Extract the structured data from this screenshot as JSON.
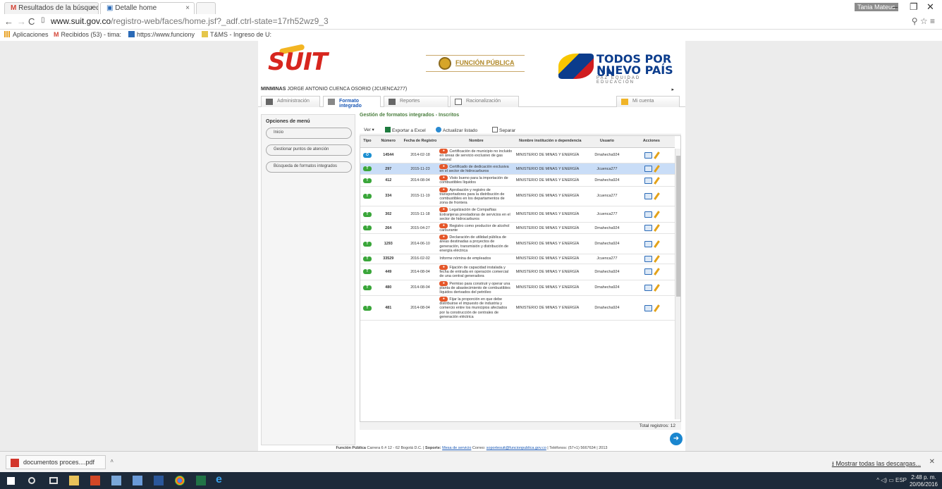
{
  "browser": {
    "tabs": [
      {
        "label": "Resultados de la búsqued",
        "active": false
      },
      {
        "label": "Detalle home",
        "active": true
      }
    ],
    "user_name": "Tania Mateus",
    "url_host": "www.suit.gov.co",
    "url_path": "/registro-web/faces/home.jsf?_adf.ctrl-state=17rh52wz9_3",
    "bookmarks": [
      {
        "label": "Aplicaciones",
        "icon": "apps-icon"
      },
      {
        "label": "Recibidos (53) - tima:",
        "icon": "gmail-icon"
      },
      {
        "label": "https://www.funciony",
        "icon": "page-icon"
      },
      {
        "label": "T&MS - Ingreso de U:",
        "icon": "folder-icon"
      }
    ]
  },
  "site": {
    "logo_text": "UIT",
    "funcion_publica_label": "FUNCIÓN PÚBLICA",
    "campaign_line1": "TODOS POR UN",
    "campaign_line2": "NUEVO PAÍS",
    "campaign_line3": "PAZ EQUIDAD EDUCACIÓN",
    "user_entity": "MINMINAS",
    "user_name": "JORGE ANTONIO CUENCA OSORIO (JCUENCA277)",
    "user_arrow": "▸",
    "menu": [
      {
        "label": "Administración",
        "icon": "user-icon",
        "active": false
      },
      {
        "label": "Formato integrado",
        "icon": "form-icon",
        "active": true
      },
      {
        "label": "Reportes",
        "icon": "report-icon",
        "active": false
      },
      {
        "label": "Racionalización",
        "icon": "edit-icon",
        "active": false
      },
      {
        "label": "Mi cuenta",
        "icon": "star-icon",
        "active": false
      }
    ],
    "left_menu_title": "Opciones de menú",
    "left_menu": [
      "Inicio",
      "Gestionar puntos de atención",
      "Búsqueda de formatos integrados"
    ],
    "main_title": "Gestión de formatos integrados - Inscritos",
    "toolbar": {
      "view": "Ver ▾",
      "export": "Exportar a Excel",
      "refresh": "Actualizar listado",
      "detach": "Separar"
    },
    "columns": [
      "Tipo",
      "Número",
      "Fecha de Registro",
      "Nombre",
      "Nombre institución o dependencia",
      "Usuario",
      "Acciones"
    ],
    "rows": [
      {
        "tipo": "O",
        "tipo_color": "blue",
        "numero": "14544",
        "fecha": "2014-02-18",
        "tag": "●",
        "nombre": "Certificación de municipio no incluido en áreas de servicio exclusivo de gas natural",
        "institucion": "MINISTERIO DE MINAS Y ENERGÍA",
        "usuario": "Dmahecha924",
        "selected": false
      },
      {
        "tipo": "T",
        "tipo_color": "green",
        "numero": "297",
        "fecha": "2015-11-23",
        "tag": "●",
        "nombre": "Certificado de dedicación exclusiva en el sector de hidrocarburos",
        "institucion": "MINISTERIO DE MINAS Y ENERGÍA",
        "usuario": "Jcuenca277",
        "selected": true
      },
      {
        "tipo": "T",
        "tipo_color": "green",
        "numero": "412",
        "fecha": "2014-08-04",
        "tag": "●",
        "nombre": "Visto bueno para la importación de combustibles líquidos",
        "institucion": "MINISTERIO DE MINAS Y ENERGÍA",
        "usuario": "Dmahecha924",
        "selected": false
      },
      {
        "tipo": "T",
        "tipo_color": "green",
        "numero": "334",
        "fecha": "2015-11-19",
        "tag": "●",
        "nombre": "Aprobación y registro de transportadores para la distribución de combustibles en los departamentos de zona de frontera",
        "institucion": "MINISTERIO DE MINAS Y ENERGÍA",
        "usuario": "Jcuenca277",
        "selected": false
      },
      {
        "tipo": "T",
        "tipo_color": "green",
        "numero": "302",
        "fecha": "2015-11-18",
        "tag": "●",
        "nombre": "Legalización de Compañías Extranjeras prestadoras de servicios en el sector de hidrocarburos",
        "institucion": "MINISTERIO DE MINAS Y ENERGÍA",
        "usuario": "Jcuenca277",
        "selected": false
      },
      {
        "tipo": "T",
        "tipo_color": "green",
        "numero": "264",
        "fecha": "2015-04-27",
        "tag": "●",
        "nombre": "Registro como productor de alcohol carburante",
        "institucion": "MINISTERIO DE MINAS Y ENERGÍA",
        "usuario": "Dmahecha924",
        "selected": false
      },
      {
        "tipo": "T",
        "tipo_color": "green",
        "numero": "1293",
        "fecha": "2014-06-10",
        "tag": "●",
        "nombre": "Declaración de utilidad pública de áreas destinadas a proyectos de generación, transmisión y distribución de energía eléctrica",
        "institucion": "MINISTERIO DE MINAS Y ENERGÍA",
        "usuario": "Dmahecha924",
        "selected": false
      },
      {
        "tipo": "T",
        "tipo_color": "green",
        "numero": "33529",
        "fecha": "2016-02-02",
        "tag": "",
        "nombre": "Informe nómina de empleados",
        "institucion": "MINISTERIO DE MINAS Y ENERGÍA",
        "usuario": "Jcuenca277",
        "selected": false
      },
      {
        "tipo": "T",
        "tipo_color": "green",
        "numero": "449",
        "fecha": "2014-08-04",
        "tag": "●",
        "nombre": "Fijación de capacidad instalada y fecha de entrada en operación comercial de una central generadora",
        "institucion": "MINISTERIO DE MINAS Y ENERGÍA",
        "usuario": "Dmahecha924",
        "selected": false
      },
      {
        "tipo": "T",
        "tipo_color": "green",
        "numero": "480",
        "fecha": "2014-08-04",
        "tag": "●",
        "nombre": "Permiso para construir y operar una planta de abastecimiento de combustibles líquidos derivados del petróleo",
        "institucion": "MINISTERIO DE MINAS Y ENERGÍA",
        "usuario": "Dmahecha924",
        "selected": false
      },
      {
        "tipo": "T",
        "tipo_color": "green",
        "numero": "481",
        "fecha": "2014-08-04",
        "tag": "●",
        "nombre": "Fijar la proporción en que debe distribuirse el impuesto de industria y comercio entre los municipios afectados por la construcción de centrales de generación eléctrica",
        "institucion": "MINISTERIO DE MINAS Y ENERGÍA",
        "usuario": "Dmahecha924",
        "selected": false
      }
    ],
    "total_label": "Total registros: 12",
    "footer": {
      "org": "Función Pública",
      "address": " Carrera 6 # 12 - 62 Bogotá D.C. | ",
      "support_label": "Soporte: ",
      "support_link": "Mesa de servicio",
      "email_label": " Correo: ",
      "email": "soportesuit@funcionpublica.gov.co",
      "phone": " | Teléfonos: (57+1) 5667634 | 2013"
    }
  },
  "downloads": {
    "file": "documentos proces....pdf",
    "show_all": "Mostrar todas las descargas..."
  },
  "taskbar": {
    "lang": "ESP",
    "time": "2:48 p. m.",
    "date": "20/06/2016"
  },
  "colors": {
    "accent_blue": "#1a58b5",
    "green_title": "#4a7e3e",
    "selected_row": "#c9ddf7",
    "badge_green": "#3aa63a",
    "badge_blue": "#1b8fd1"
  }
}
